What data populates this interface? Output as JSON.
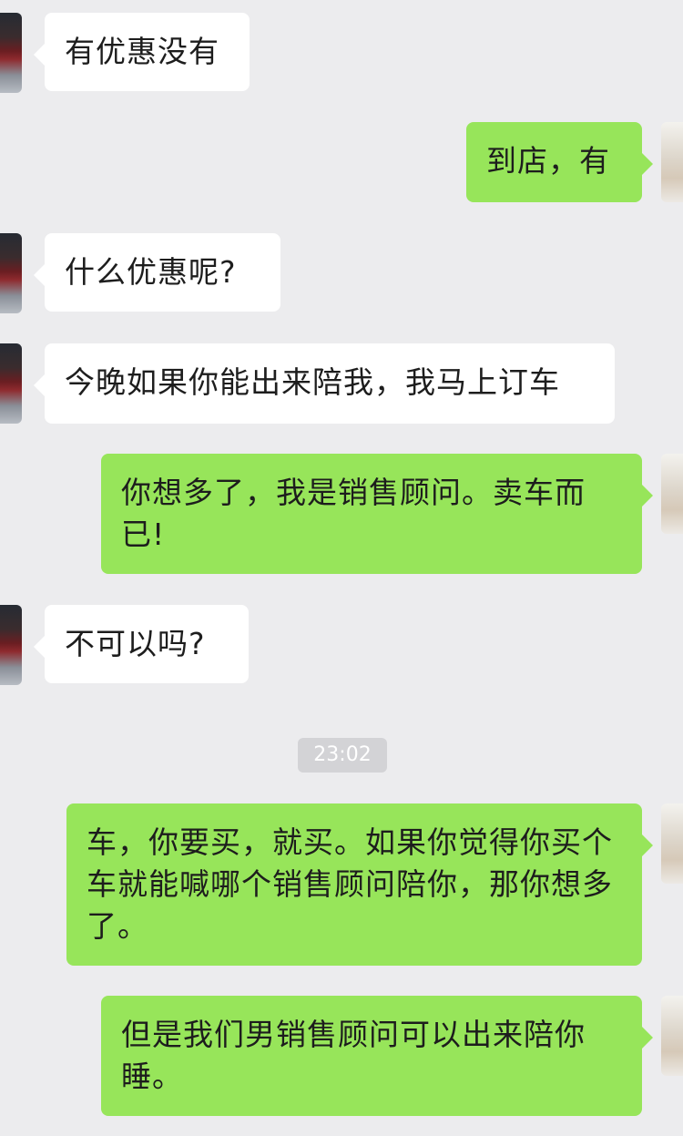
{
  "conversation": {
    "timestamp": "23:02",
    "messages": [
      {
        "sender": "other",
        "text": "有优惠没有"
      },
      {
        "sender": "me",
        "text": "到店，有"
      },
      {
        "sender": "other",
        "text": "什么优惠呢?"
      },
      {
        "sender": "other",
        "text": "今晚如果你能出来陪我，我马上订车"
      },
      {
        "sender": "me",
        "text": "你想多了，我是销售顾问。卖车而已!"
      },
      {
        "sender": "other",
        "text": "不可以吗?"
      },
      {
        "sender": "me",
        "text": "车，你要买，就买。如果你觉得你买个车就能喊哪个销售顾问陪你，那你想多了。"
      },
      {
        "sender": "me",
        "text": "但是我们男销售顾问可以出来陪你睡。"
      }
    ]
  }
}
